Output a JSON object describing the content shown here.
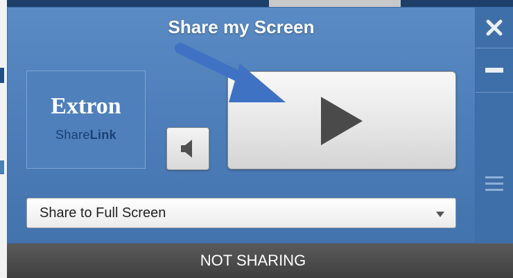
{
  "window": {
    "title": "Share my Screen"
  },
  "logo": {
    "brand": "Extron",
    "product_share": "Share",
    "product_link": "Link"
  },
  "controls": {
    "audio_icon": "speaker-icon",
    "share_icon": "play-icon"
  },
  "dropdown": {
    "selected": "Share to Full Screen"
  },
  "side_panel": {
    "close_icon": "close-icon",
    "minimize_icon": "minimize-icon",
    "menu_icon": "menu-icon"
  },
  "status": {
    "text": "NOT SHARING"
  },
  "colors": {
    "panel_blue": "#5b8bc4",
    "side_blue": "#3f6fa8",
    "arrow_blue": "#3f72c3",
    "status_gray": "#4a4a4a"
  }
}
